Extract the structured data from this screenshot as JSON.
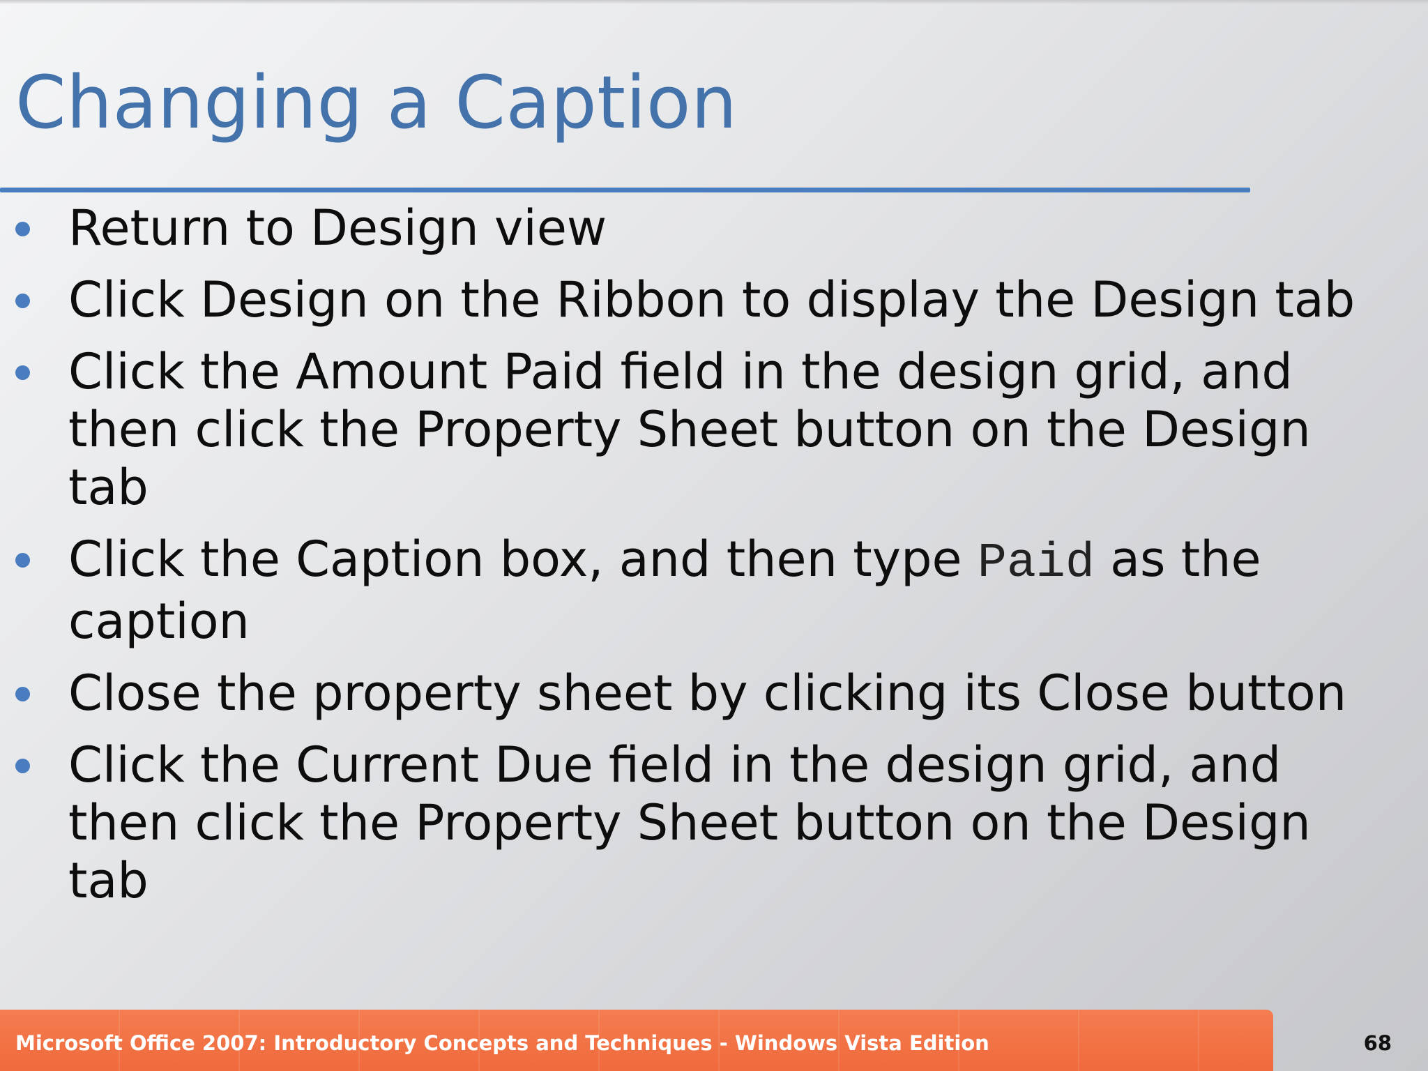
{
  "slide": {
    "title": "Changing a Caption",
    "bullets": [
      {
        "text": "Return to Design view"
      },
      {
        "text": "Click Design on the Ribbon to display the Design tab"
      },
      {
        "text": "Click the Amount Paid field in the design grid, and then click the Property Sheet button on the Design tab"
      },
      {
        "before": "Click the Caption box, and then type ",
        "code": "Paid",
        "after": " as the caption"
      },
      {
        "text": "Close the property sheet by clicking its Close button"
      },
      {
        "text": "Click the Current Due field in the design grid, and then click the Property Sheet button on the Design tab"
      }
    ],
    "footer": "Microsoft Office 2007: Introductory Concepts and Techniques - Windows Vista Edition",
    "page_number": "68"
  },
  "colors": {
    "title": "#4472aa",
    "accent_rule": "#4a7cc0",
    "bullet_dot": "#4a7cc0",
    "footer_bar": "#f06a3c"
  }
}
